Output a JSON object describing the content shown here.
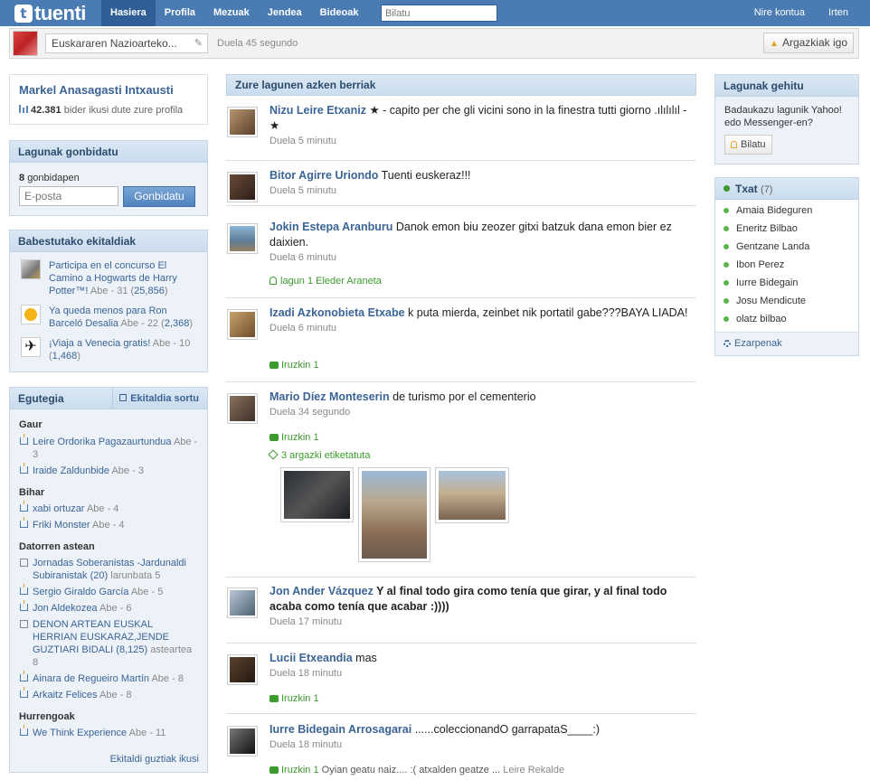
{
  "topbar": {
    "logo_text": "tuenti",
    "logo_badge": "t",
    "nav": [
      "Hasiera",
      "Profila",
      "Mezuak",
      "Jendea",
      "Bideoak"
    ],
    "search_placeholder": "Bilatu",
    "account": "Nire kontua",
    "logout": "Irten"
  },
  "status": {
    "text": "Euskararen Nazioarteko...",
    "time": "Duela 45 segundo",
    "upload": "Argazkiak igo"
  },
  "profile": {
    "name": "Markel Anasagasti Intxausti",
    "views_count": "42.381",
    "views_text": "bider ikusi dute zure profila"
  },
  "invite": {
    "title": "Lagunak gonbidatu",
    "count": "8",
    "count_label": "gonbidapen",
    "placeholder": "E-posta",
    "button": "Gonbidatu"
  },
  "events": {
    "title": "Babestutako ekitaldiak",
    "items": [
      {
        "title": "Participa en el concurso El Camino a Hogwarts de Harry Potter™!",
        "meta_pre": "Abe - 31 (",
        "count": "25,856",
        "meta_post": ")"
      },
      {
        "title": "Ya queda menos para Ron Barceló Desalia",
        "meta_pre": "Abe - 22 (",
        "count": "2,368",
        "meta_post": ")"
      },
      {
        "title": "¡Viaja a Venecia gratis!",
        "meta_pre": "Abe - 10 (",
        "count": "1,468",
        "meta_post": ")"
      }
    ]
  },
  "calendar": {
    "title": "Egutegia",
    "create": "Ekitaldia sortu",
    "sections": {
      "today": "Gaur",
      "tomorrow": "Bihar",
      "next_week": "Datorren astean",
      "upcoming": "Hurrengoak"
    },
    "items": [
      {
        "name": "Leire Ordorika Pagazaurtundua",
        "meta": "Abe - 3"
      },
      {
        "name": "Iraide Zaldunbide",
        "meta": "Abe - 3"
      },
      {
        "name": "xabi ortuzar",
        "meta": "Abe - 4"
      },
      {
        "name": "Friki Monster",
        "meta": "Abe - 4"
      },
      {
        "name": "Jornadas Soberanistas -Jardunaldi Subiranistak",
        "count": "20",
        "meta": "larunbata 5"
      },
      {
        "name": "Sergio Giraldo García",
        "meta": "Abe - 5"
      },
      {
        "name": "Jon Aldekozea",
        "meta": "Abe - 6"
      },
      {
        "name": "DENON ARTEAN EUSKAL HERRIAN EUSKARAZ,JENDE GUZTIARI BIDALI",
        "count": "8,125",
        "meta": "asteartea 8"
      },
      {
        "name": "Ainara de Regueiro Martín",
        "meta": "Abe - 8"
      },
      {
        "name": "Arkaitz Felices",
        "meta": "Abe - 8"
      },
      {
        "name": "We Think Experience",
        "meta": "Abe - 11"
      }
    ],
    "footer": "Ekitaldi guztiak ikusi"
  },
  "feed": {
    "title": "Zure lagunen azken berriak",
    "posts": [
      {
        "author": "Nizu Leire Etxaniz",
        "text": " ★ - capito per che gli vicini sono in la finestra tutti giorno .ılılılıl - ★",
        "time": "Duela 5 minutu"
      },
      {
        "author": "Bitor Agirre Uriondo",
        "text": " Tuenti euskeraz!!!",
        "time": "Duela 5 minutu"
      },
      {
        "author": "Jokin Estepa Aranburu",
        "text": " Danok emon biu zeozer gitxi batzuk dana emon bier ez daixien.",
        "time": "Duela 6 minutu",
        "extra_a": "lagun 1",
        "extra_b": "Eleder Araneta"
      },
      {
        "author": "Izadi Azkonobieta Etxabe",
        "text": " k puta mierda, zeinbet nik portatil gabe???BAYA LIADA!",
        "time": "Duela 6 minutu",
        "extra_a": "Iruzkin 1"
      },
      {
        "author": "Mario Díez Monteserin",
        "text": " de turismo por el cementerio",
        "time": "Duela 34 segundo",
        "extra_a": "Iruzkin 1",
        "extra_b": "3 argazki etiketatuta"
      },
      {
        "author": "Jon Ander Vázquez",
        "text": " Y al final todo gira como tenía que girar, y al final todo acaba como tenía que acabar :))))",
        "time": "Duela 17 minutu"
      },
      {
        "author": "Lucii Etxeandia",
        "text": " mas",
        "time": "Duela 18 minutu",
        "extra_a": "Iruzkin 1"
      },
      {
        "author": "Iurre Bidegain Arrosagarai",
        "text": " ......coleccionandO garrapataS____:)",
        "time": "Duela 18 minutu",
        "extra_a": "Iruzkin 1",
        "extra_b": "Oyian geatu naiz.... :( atxalden geatze ...",
        "extra_c": "Leire Rekalde"
      }
    ]
  },
  "add_friends": {
    "title": "Lagunak gehitu",
    "text": "Badaukazu lagunik Yahoo! edo Messenger-en?",
    "button": "Bilatu"
  },
  "chat": {
    "title": "Txat",
    "count": "(7)",
    "users": [
      "Amaia Bideguren",
      "Eneritz Bilbao",
      "Gentzane Landa",
      "Ibon Perez",
      "Iurre Bidegain",
      "Josu Mendicute",
      "olatz bilbao"
    ],
    "settings": "Ezarpenak"
  },
  "colors": {
    "topbar": "#4a7bb2",
    "link": "#3b6496",
    "green": "#3c9a2e"
  }
}
